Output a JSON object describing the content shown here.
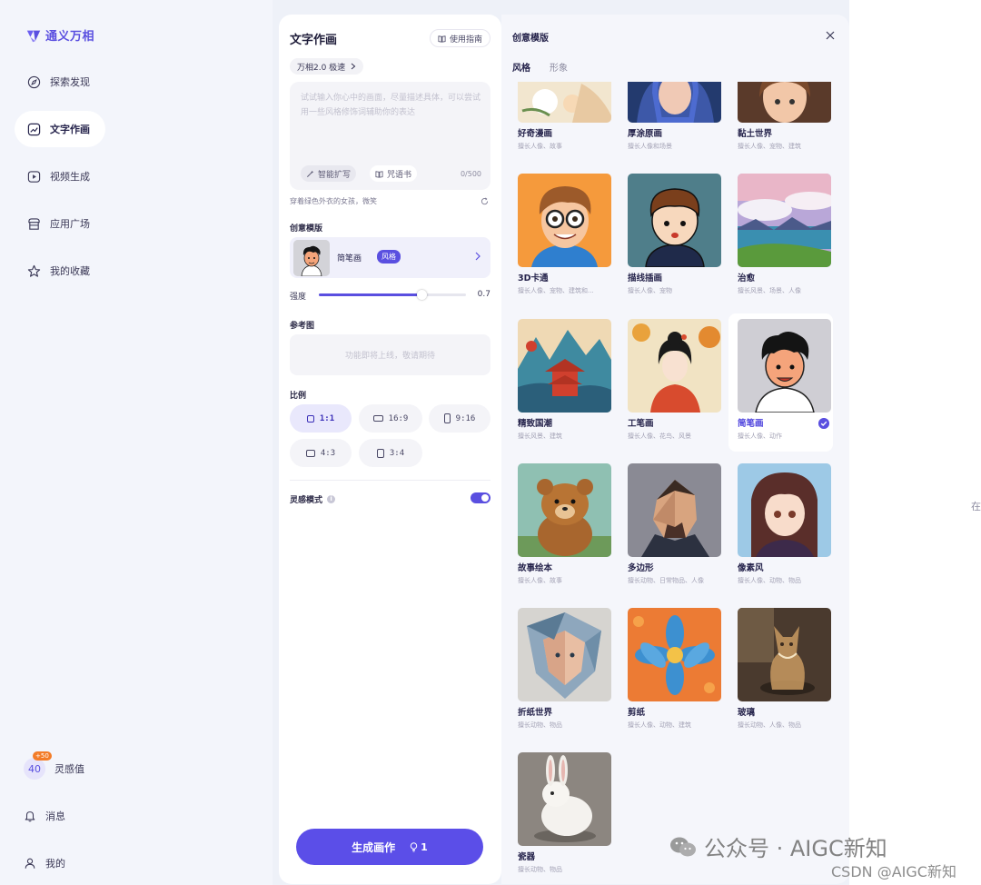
{
  "app": {
    "name": "通义万相"
  },
  "nav": [
    {
      "label": "探索发现",
      "icon": "compass-icon"
    },
    {
      "label": "文字作画",
      "icon": "image-icon",
      "active": true
    },
    {
      "label": "视频生成",
      "icon": "play-icon"
    },
    {
      "label": "应用广场",
      "icon": "store-icon"
    },
    {
      "label": "我的收藏",
      "icon": "star-icon"
    }
  ],
  "bottom": {
    "points": "40",
    "points_badge": "+50",
    "points_label": "灵感值",
    "messages_label": "消息",
    "profile_label": "我的"
  },
  "panel": {
    "title": "文字作画",
    "guide_label": "使用指南",
    "model_label": "万相2.0 极速",
    "prompt_placeholder": "试试输入你心中的画面，尽量描述具体，可以尝试用一些风格修饰词辅助你的表达",
    "expand_label": "智能扩写",
    "spell_label": "咒语书",
    "counter": "0/500",
    "hint": "穿着绿色外衣的女孩，微笑",
    "template_section": "创意模版",
    "template_name": "简笔画",
    "template_tag": "风格",
    "strength_label": "强度",
    "strength_value": "0.7",
    "strength_fraction": 0.7,
    "reference_section": "参考图",
    "reference_placeholder": "功能即将上线，敬请期待",
    "ratio_section": "比例",
    "ratios": [
      "1:1",
      "16:9",
      "9:16",
      "4:3",
      "3:4"
    ],
    "selected_ratio": "1:1",
    "inspiration_label": "灵感模式",
    "inspiration_on": true,
    "generate_label": "生成画作",
    "generate_cost": "1"
  },
  "modal": {
    "title": "创意模版",
    "tabs": [
      "风格",
      "形象"
    ],
    "active_tab": "风格",
    "templates": [
      {
        "title": "好奇漫画",
        "desc": "擅长人像、故事"
      },
      {
        "title": "厚涂原画",
        "desc": "擅长人像和场景"
      },
      {
        "title": "黏土世界",
        "desc": "擅长人像、宠物、建筑"
      },
      {
        "title": "3D卡通",
        "desc": "擅长人像、宠物、建筑和..."
      },
      {
        "title": "描线插画",
        "desc": "擅长人像、宠物"
      },
      {
        "title": "治愈",
        "desc": "擅长风景、场景、人像"
      },
      {
        "title": "精致国潮",
        "desc": "擅长风景、建筑"
      },
      {
        "title": "工笔画",
        "desc": "擅长人像、花鸟、风景"
      },
      {
        "title": "简笔画",
        "desc": "擅长人像、动作",
        "selected": true
      },
      {
        "title": "故事绘本",
        "desc": "擅长人像、故事"
      },
      {
        "title": "多边形",
        "desc": "擅长动物、日常物品、人像"
      },
      {
        "title": "像素风",
        "desc": "擅长人像、动物、物品"
      },
      {
        "title": "折纸世界",
        "desc": "擅长动物、物品"
      },
      {
        "title": "剪纸",
        "desc": "擅长人像、动物、建筑"
      },
      {
        "title": "玻璃",
        "desc": "擅长动物、人像、物品"
      },
      {
        "title": "瓷器",
        "desc": "擅长动物、物品"
      }
    ]
  },
  "right_hint": "在",
  "watermark": {
    "line1": "公众号 · AIGC新知",
    "line2": "CSDN @AIGC新知"
  },
  "colors": {
    "accent": "#5a4fe0",
    "badge": "#f37c28"
  }
}
